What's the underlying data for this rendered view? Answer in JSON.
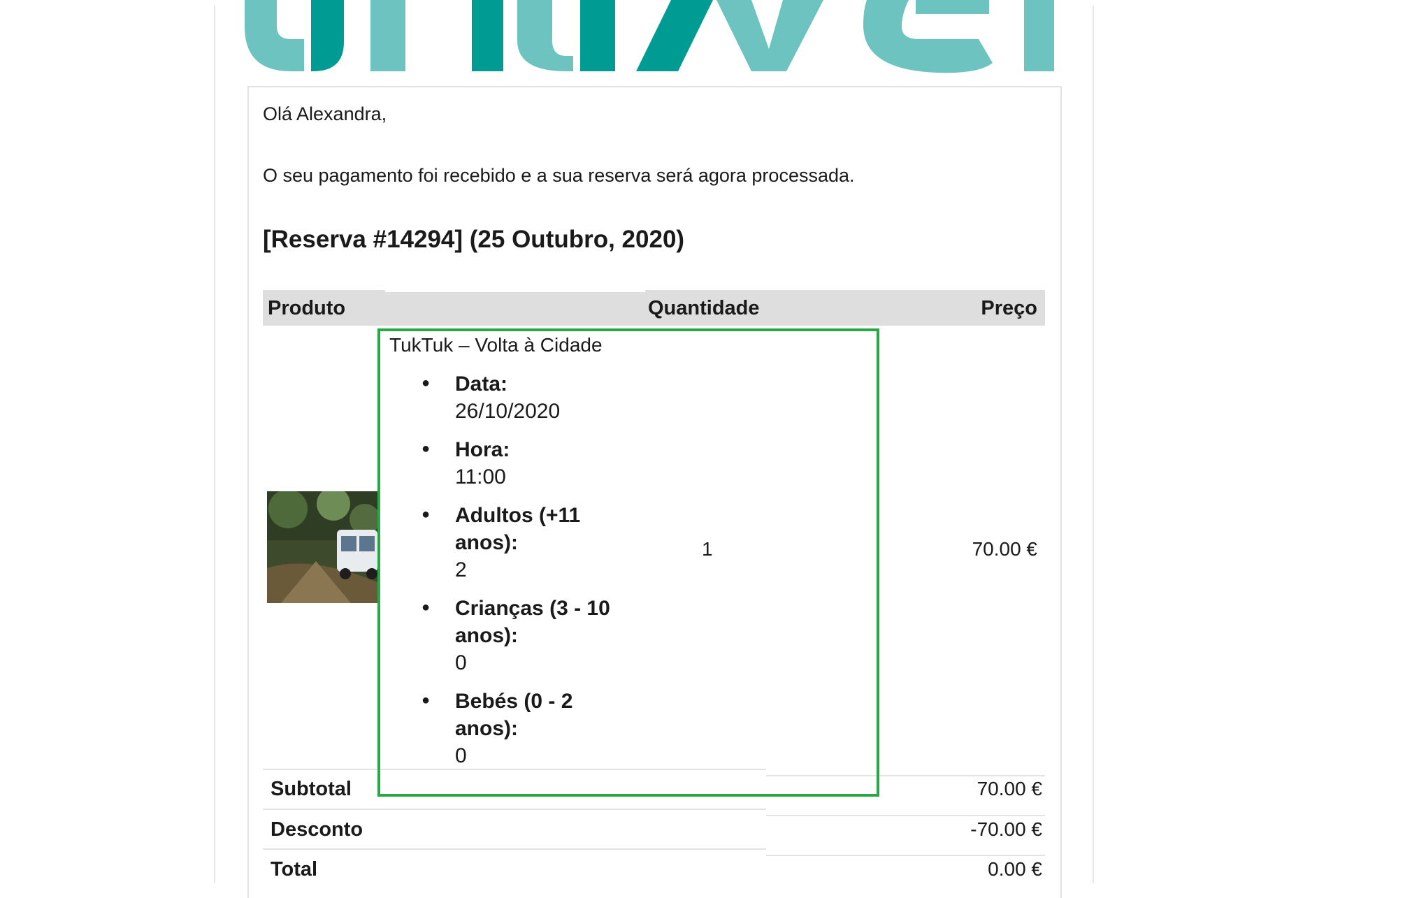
{
  "brand": {
    "logo_text": "unduvel",
    "logo_color": "#009c94",
    "logo_color_light": "#6cc3bf"
  },
  "email": {
    "greeting": "Olá Alexandra,",
    "message": "O seu pagamento foi recebido e a sua reserva será agora processada.",
    "order_heading": "[Reserva #14294] (25 Outubro, 2020)"
  },
  "table": {
    "headers": {
      "product": "Produto",
      "quantity": "Quantidade",
      "price": "Preço"
    },
    "item": {
      "name": "TukTuk – Volta à Cidade",
      "details": [
        {
          "label": "Data:",
          "value": "26/10/2020"
        },
        {
          "label": "Hora:",
          "value": "11:00"
        },
        {
          "label": "Adultos (+11 anos):",
          "value": "2"
        },
        {
          "label": "Crianças (3 - 10 anos):",
          "value": "0"
        },
        {
          "label": "Bebés (0 - 2 anos):",
          "value": "0"
        }
      ],
      "quantity": "1",
      "price": "70.00 €"
    },
    "totals": [
      {
        "label": "Subtotal",
        "value": "70.00 €"
      },
      {
        "label": "Desconto",
        "value": "-70.00 €"
      },
      {
        "label": "Total",
        "value": "0.00 €"
      }
    ]
  },
  "colors": {
    "highlight": "#28a745",
    "header_bg": "#dedede"
  }
}
